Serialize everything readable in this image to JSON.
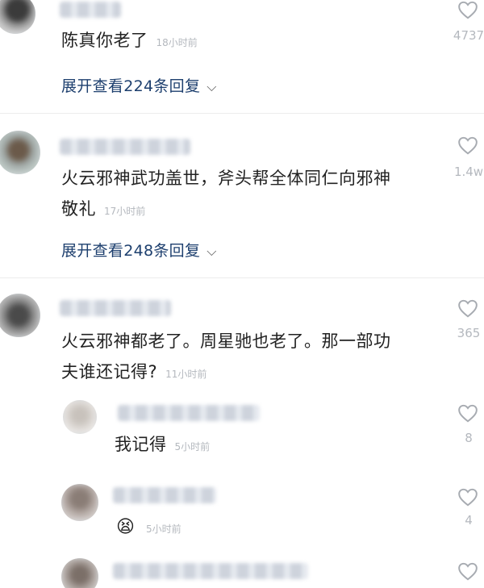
{
  "comments": [
    {
      "text": "陈真你老了",
      "time": "18小时前",
      "likes": "4737",
      "expand": "展开查看224条回复"
    },
    {
      "text_line1": "火云邪神武功盖世，斧头帮全体同仁向邪神",
      "text_line2": "敬礼",
      "time": "17小时前",
      "likes": "1.4w",
      "expand": "展开查看248条回复"
    },
    {
      "text_line1": "火云邪神都老了。周星驰也老了。那一部功",
      "text_line2": "夫谁还记得?",
      "time": "11小时前",
      "likes": "365"
    }
  ],
  "replies": [
    {
      "text": "我记得",
      "time": "5小时前",
      "likes": "8"
    },
    {
      "emoji": "😫",
      "time": "5小时前",
      "likes": "4"
    },
    {
      "likes": ""
    }
  ],
  "colors": {
    "link": "#1d3f6e",
    "muted": "#b4b8be"
  },
  "icons": {
    "like": "heart-outline-icon",
    "expand": "chevron-down-icon"
  }
}
